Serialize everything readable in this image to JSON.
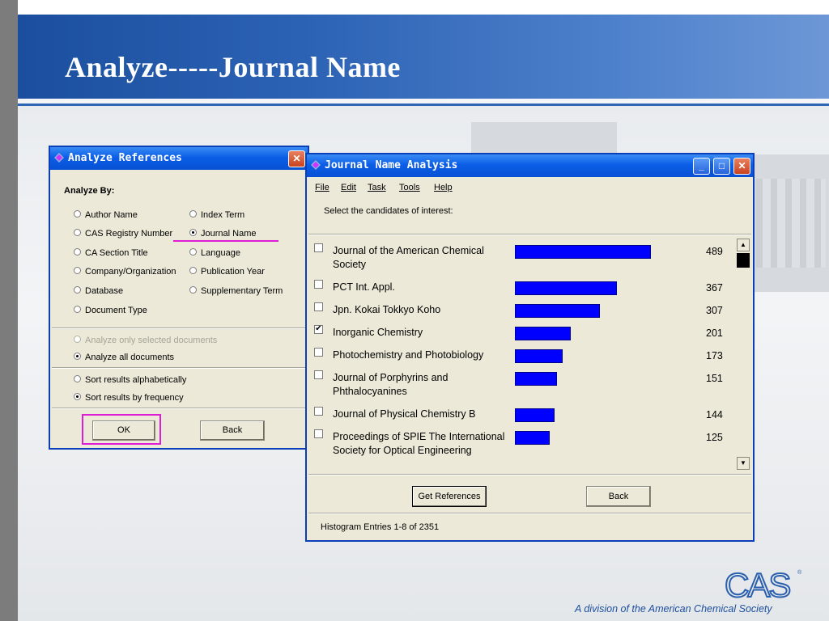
{
  "slide": {
    "title": "Analyze-----Journal Name",
    "footer": "A division of the American Chemical Society",
    "logo_text": "CAS"
  },
  "analyze_refs": {
    "title": "Analyze References",
    "analyze_by_label": "Analyze By:",
    "options_left": [
      "Author Name",
      "CAS Registry Number",
      "CA Section Title",
      "Company/Organization",
      "Database",
      "Document Type"
    ],
    "options_right": [
      "Index Term",
      "Journal Name",
      "Language",
      "Publication Year",
      "Supplementary Term"
    ],
    "selected": "Journal Name",
    "scope_options": [
      "Analyze only selected documents",
      "Analyze all documents"
    ],
    "scope_selected": "Analyze all documents",
    "sort_options": [
      "Sort results alphabetically",
      "Sort results by frequency"
    ],
    "sort_selected": "Sort results by frequency",
    "ok_label": "OK",
    "back_label": "Back"
  },
  "journal_analysis": {
    "title": "Journal Name Analysis",
    "menu": [
      "File",
      "Edit",
      "Task",
      "Tools",
      "Help"
    ],
    "instruction": "Select the candidates of interest:",
    "rows": [
      {
        "name": "Journal of the American Chemical Society",
        "count": "489",
        "value": 489,
        "checked": false
      },
      {
        "name": "PCT Int. Appl.",
        "count": "367",
        "value": 367,
        "checked": false
      },
      {
        "name": "Jpn. Kokai Tokkyo Koho",
        "count": "307",
        "value": 307,
        "checked": false
      },
      {
        "name": "Inorganic Chemistry",
        "count": "201",
        "value": 201,
        "checked": true
      },
      {
        "name": "Photochemistry and Photobiology",
        "count": "173",
        "value": 173,
        "checked": false
      },
      {
        "name": "Journal of Porphyrins and Phthalocyanines",
        "count": "151",
        "value": 151,
        "checked": false
      },
      {
        "name": "Journal of Physical Chemistry B",
        "count": "144",
        "value": 144,
        "checked": false
      },
      {
        "name": "Proceedings of SPIE The International Society for Optical Engineering",
        "count": "125",
        "value": 125,
        "checked": false
      }
    ],
    "get_refs_label": "Get References",
    "back_label": "Back",
    "status": "Histogram Entries 1-8 of 2351"
  },
  "colors": {
    "bar": "#0000ff",
    "title_bar": "#0b5ee6",
    "highlight": "#e01cd6",
    "brand_blue": "#1b4e9e"
  }
}
